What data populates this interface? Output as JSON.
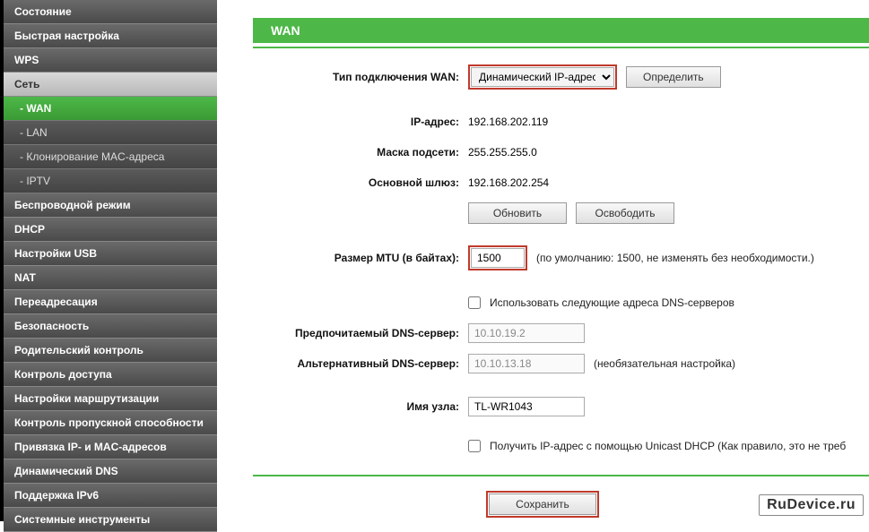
{
  "sidebar": {
    "items": [
      {
        "label": "Состояние",
        "type": "item"
      },
      {
        "label": "Быстрая настройка",
        "type": "item"
      },
      {
        "label": "WPS",
        "type": "item"
      },
      {
        "label": "Сеть",
        "type": "item",
        "active": true
      },
      {
        "label": "- WAN",
        "type": "sub",
        "active": true
      },
      {
        "label": "- LAN",
        "type": "sub"
      },
      {
        "label": "- Клонирование MAC-адреса",
        "type": "sub"
      },
      {
        "label": "- IPTV",
        "type": "sub"
      },
      {
        "label": "Беспроводной режим",
        "type": "item"
      },
      {
        "label": "DHCP",
        "type": "item"
      },
      {
        "label": "Настройки USB",
        "type": "item"
      },
      {
        "label": "NAT",
        "type": "item"
      },
      {
        "label": "Переадресация",
        "type": "item"
      },
      {
        "label": "Безопасность",
        "type": "item"
      },
      {
        "label": "Родительский контроль",
        "type": "item"
      },
      {
        "label": "Контроль доступа",
        "type": "item"
      },
      {
        "label": "Настройки маршрутизации",
        "type": "item"
      },
      {
        "label": "Контроль пропускной способности",
        "type": "item"
      },
      {
        "label": "Привязка IP- и MAC-адресов",
        "type": "item"
      },
      {
        "label": "Динамический DNS",
        "type": "item"
      },
      {
        "label": "Поддержка IPv6",
        "type": "item"
      },
      {
        "label": "Системные инструменты",
        "type": "item"
      }
    ]
  },
  "page": {
    "title": "WAN"
  },
  "wan": {
    "conn_type_label": "Тип подключения WAN:",
    "conn_type_value": "Динамический IP-адрес",
    "detect_btn": "Определить",
    "ip_label": "IP-адрес:",
    "ip_value": "192.168.202.119",
    "mask_label": "Маска подсети:",
    "mask_value": "255.255.255.0",
    "gateway_label": "Основной шлюз:",
    "gateway_value": "192.168.202.254",
    "renew_btn": "Обновить",
    "release_btn": "Освободить",
    "mtu_label": "Размер MTU (в байтах):",
    "mtu_value": "1500",
    "mtu_hint": "(по умолчанию: 1500, не изменять без необходимости.)",
    "use_dns_label": "Использовать следующие адреса DNS-серверов",
    "dns1_label": "Предпочитаемый DNS-сервер:",
    "dns1_value": "10.10.19.2",
    "dns2_label": "Альтернативный DNS-сервер:",
    "dns2_value": "10.10.13.18",
    "dns2_hint": "(необязательная настройка)",
    "hostname_label": "Имя узла:",
    "hostname_value": "TL-WR1043",
    "unicast_label": "Получить IP-адрес с помощью Unicast DHCP (Как правило, это не треб",
    "save_btn": "Сохранить"
  },
  "watermark": "RuDevice.ru"
}
